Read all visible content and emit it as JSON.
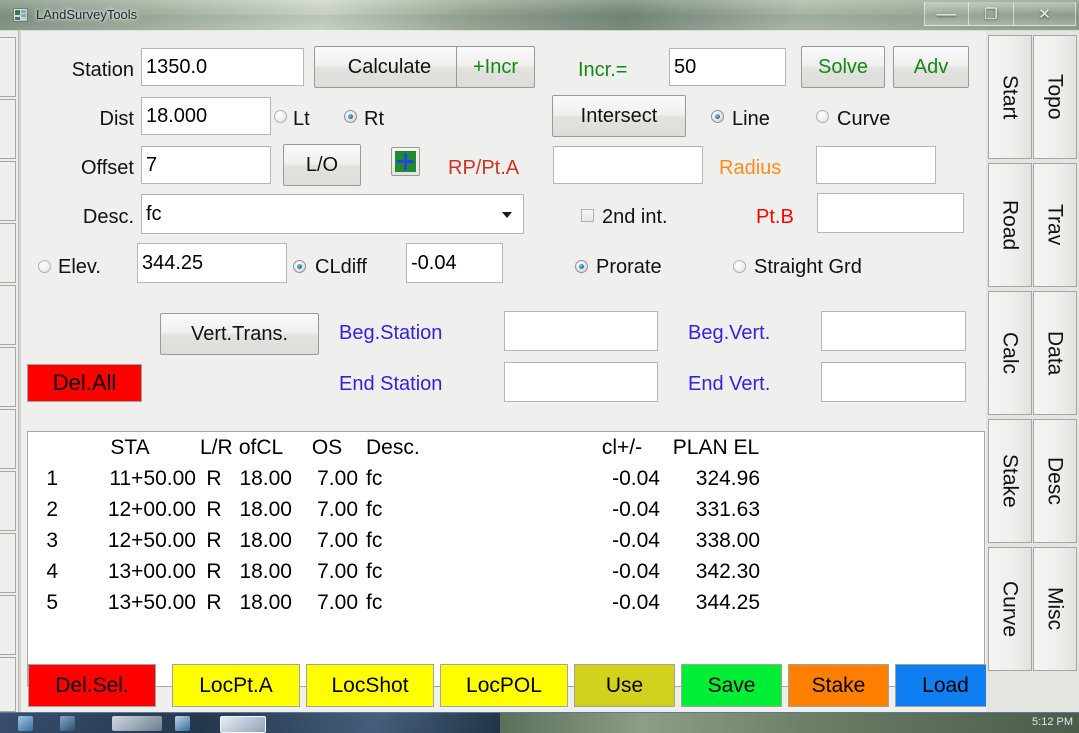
{
  "window": {
    "title": "LAndSurveyTools",
    "icon": "app-icon",
    "minimize": "minimize-icon",
    "maximize": "restore-icon",
    "close": "close-icon"
  },
  "form": {
    "station": {
      "label": "Station",
      "value": "1350.0"
    },
    "calculate_button": "Calculate",
    "incr_button": "+Incr",
    "incr_label": "Incr.=",
    "incr_value": "50",
    "solve_button": "Solve",
    "adv_button": "Adv",
    "dist": {
      "label": "Dist",
      "value": "18.000"
    },
    "side": {
      "left_label": "Lt",
      "right_label": "Rt",
      "selected": "Rt"
    },
    "intersect_button": "Intersect",
    "geom": {
      "line_label": "Line",
      "curve_label": "Curve",
      "selected": "Line"
    },
    "offset": {
      "label": "Offset",
      "value": "7"
    },
    "lo_button": "L/O",
    "add_button_icon": "plus-icon",
    "rp_pta": {
      "label": "RP/Pt.A",
      "value": ""
    },
    "radius": {
      "label": "Radius",
      "value": ""
    },
    "desc": {
      "label": "Desc.",
      "value": "fc",
      "dropdown_icon": "chevron-down-icon"
    },
    "second_int": {
      "label": "2nd int.",
      "checked": false
    },
    "ptb": {
      "label": "Pt.B",
      "value": ""
    },
    "elev": {
      "label": "Elev.",
      "value": "344.25",
      "selected": false
    },
    "cldiff": {
      "label": "CLdiff",
      "value": "-0.04",
      "selected": true
    },
    "grade_mode": {
      "prorate_label": "Prorate",
      "straight_label": "Straight Grd",
      "selected": "Prorate"
    },
    "vert_trans_button": "Vert.Trans.",
    "beg_station": {
      "label": "Beg.Station",
      "value": ""
    },
    "beg_vert": {
      "label": "Beg.Vert.",
      "value": ""
    },
    "del_all_button": "Del.All",
    "end_station": {
      "label": "End Station",
      "value": ""
    },
    "end_vert": {
      "label": "End Vert.",
      "value": ""
    }
  },
  "table": {
    "headers": {
      "idx": "",
      "sta": "STA",
      "lr": "L/R",
      "ofcl": "ofCL",
      "os": "OS",
      "desc": "Desc.",
      "cl": "cl+/-",
      "el": "PLAN EL"
    },
    "rows": [
      {
        "idx": "1",
        "sta": "11+50.00",
        "lr": "R",
        "ofcl": "18.00",
        "os": "7.00",
        "desc": "fc",
        "cl": "-0.04",
        "el": "324.96"
      },
      {
        "idx": "2",
        "sta": "12+00.00",
        "lr": "R",
        "ofcl": "18.00",
        "os": "7.00",
        "desc": "fc",
        "cl": "-0.04",
        "el": "331.63"
      },
      {
        "idx": "3",
        "sta": "12+50.00",
        "lr": "R",
        "ofcl": "18.00",
        "os": "7.00",
        "desc": "fc",
        "cl": "-0.04",
        "el": "338.00"
      },
      {
        "idx": "4",
        "sta": "13+00.00",
        "lr": "R",
        "ofcl": "18.00",
        "os": "7.00",
        "desc": "fc",
        "cl": "-0.04",
        "el": "342.30"
      },
      {
        "idx": "5",
        "sta": "13+50.00",
        "lr": "R",
        "ofcl": "18.00",
        "os": "7.00",
        "desc": "fc",
        "cl": "-0.04",
        "el": "344.25"
      }
    ]
  },
  "bottom_buttons": [
    {
      "label": "Del.Sel.",
      "color": "#ff0000"
    },
    {
      "label": "LocPt.A",
      "color": "#ffff00"
    },
    {
      "label": "LocShot",
      "color": "#ffff00"
    },
    {
      "label": "LocPOL",
      "color": "#ffff00"
    },
    {
      "label": "Use",
      "color": "#d2d21e"
    },
    {
      "label": "Save",
      "color": "#00ee33"
    },
    {
      "label": "Stake",
      "color": "#ff8000"
    },
    {
      "label": "Load",
      "color": "#0f7ef0"
    }
  ],
  "vertical_tabs": {
    "column_a": [
      "Start",
      "Road",
      "Calc",
      "Stake",
      "Curve"
    ],
    "column_b": [
      "Topo",
      "Trav",
      "Data",
      "Desc",
      "Misc"
    ]
  },
  "colors": {
    "label_blue": "#3322dd",
    "label_red": "#cc3322",
    "label_orange": "#ff8c1a",
    "label_red_bright": "#ff0000",
    "green_text": "#118a11",
    "form_bg": "#efefee"
  },
  "taskbar": {
    "clock": "5:12 PM"
  }
}
